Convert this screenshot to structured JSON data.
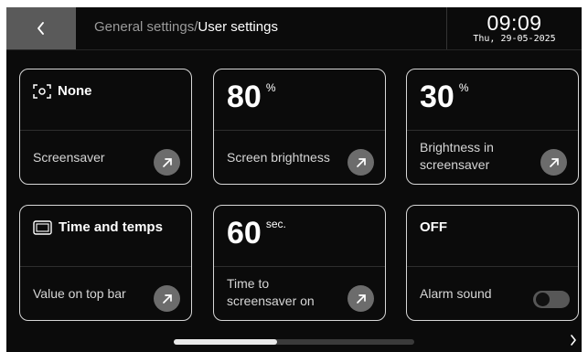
{
  "header": {
    "breadcrumb_parent": "General settings/",
    "breadcrumb_current": "User settings",
    "time": "09:09",
    "date": "Thu, 29-05-2025"
  },
  "cards": [
    {
      "id": "screensaver",
      "value": "None",
      "value_icon": "screensaver-icon",
      "label": "Screensaver",
      "action": "arrow-up-right-icon"
    },
    {
      "id": "brightness",
      "value": "80",
      "unit": "%",
      "label": "Screen brightness",
      "action": "arrow-up-right-icon"
    },
    {
      "id": "brightness-screensaver",
      "value": "30",
      "unit": "%",
      "label_line1": "Brightness in",
      "label_line2": "screensaver",
      "action": "arrow-up-right-icon"
    },
    {
      "id": "top-bar-value",
      "value": "Time and temps",
      "value_icon": "display-frame-icon",
      "label": "Value on top bar",
      "action": "arrow-up-right-icon"
    },
    {
      "id": "screensaver-timeout",
      "value": "60",
      "unit": "sec.",
      "label_line1": "Time to",
      "label_line2": "screensaver on",
      "action": "arrow-up-right-icon"
    },
    {
      "id": "alarm-sound",
      "value": "OFF",
      "label": "Alarm sound",
      "toggle_on": false
    }
  ],
  "pagination": {
    "position": "first of multiple",
    "next_icon": "chevron-right-icon"
  },
  "colors": {
    "background": "#0b0b0b",
    "card_border": "#d7d7d7",
    "back_button": "#5a5a5a",
    "arrow_button": "#6c6c6c"
  }
}
